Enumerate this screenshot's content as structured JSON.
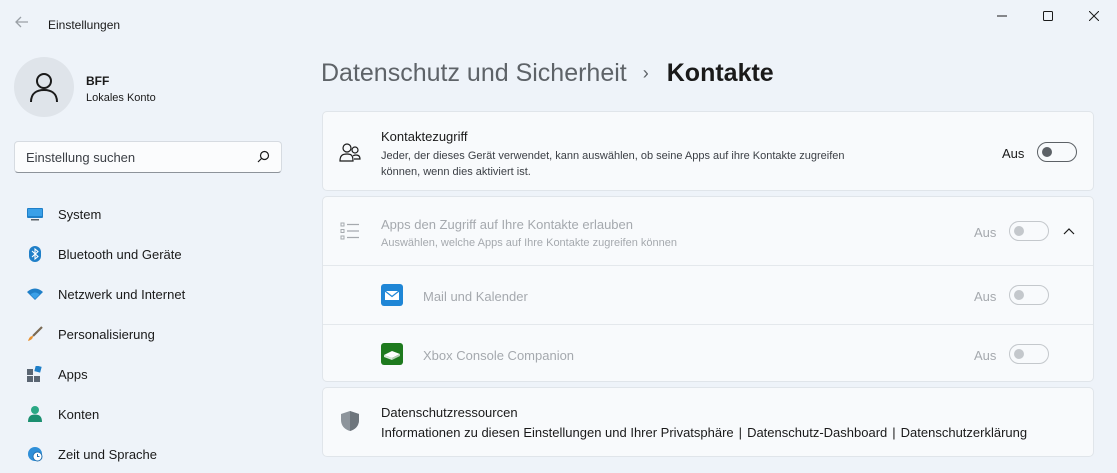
{
  "window": {
    "app_title": "Einstellungen"
  },
  "user": {
    "name": "BFF",
    "account_type": "Lokales Konto"
  },
  "search": {
    "placeholder": "Einstellung suchen"
  },
  "nav": {
    "items": [
      {
        "label": "System",
        "icon": "monitor-icon"
      },
      {
        "label": "Bluetooth und Geräte",
        "icon": "bluetooth-icon"
      },
      {
        "label": "Netzwerk und Internet",
        "icon": "wifi-icon"
      },
      {
        "label": "Personalisierung",
        "icon": "brush-icon"
      },
      {
        "label": "Apps",
        "icon": "apps-icon"
      },
      {
        "label": "Konten",
        "icon": "person-icon"
      },
      {
        "label": "Zeit und Sprache",
        "icon": "globe-clock-icon"
      }
    ]
  },
  "header": {
    "parent": "Datenschutz und Sicherheit",
    "separator": "›",
    "current": "Kontakte"
  },
  "contacts_access": {
    "title": "Kontaktezugriff",
    "description_line1": "Jeder, der dieses Gerät verwendet, kann auswählen, ob seine Apps auf ihre Kontakte zugreifen",
    "description_line2": "können, wenn dies aktiviert ist.",
    "state_label": "Aus",
    "enabled": false
  },
  "apps_access": {
    "title": "Apps den Zugriff auf Ihre Kontakte erlauben",
    "description": "Auswählen, welche Apps auf Ihre Kontakte zugreifen können",
    "state_label": "Aus",
    "expanded": true,
    "apps": [
      {
        "name": "Mail und Kalender",
        "state_label": "Aus",
        "icon": "mail-calendar-icon"
      },
      {
        "name": "Xbox Console Companion",
        "state_label": "Aus",
        "icon": "xbox-console-icon"
      }
    ]
  },
  "resources": {
    "title": "Datenschutzressourcen",
    "links": [
      "Informationen zu diesen Einstellungen und Ihrer Privatsphäre",
      "Datenschutz-Dashboard",
      "Datenschutzerklärung"
    ],
    "separator": "|"
  },
  "colors": {
    "background": "#eef3f9",
    "card": "#f8fafc",
    "accent": "#0067c0"
  }
}
